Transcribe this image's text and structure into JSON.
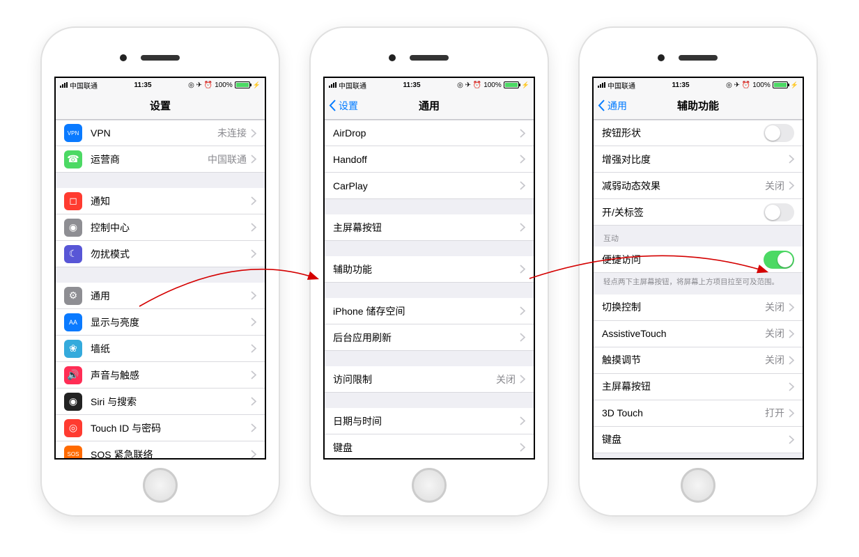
{
  "status": {
    "carrier": "中国联通",
    "time": "11:35",
    "battery": "100%"
  },
  "phone1": {
    "title": "设置",
    "rows": [
      {
        "label": "VPN",
        "value": "未连接",
        "iconBg": "#0a7aff",
        "iconText": "VPN",
        "iconTextSize": "8px"
      },
      {
        "label": "运营商",
        "value": "中国联通",
        "iconBg": "#4cd964",
        "iconText": "☎"
      }
    ],
    "group2": [
      {
        "label": "通知",
        "iconBg": "#ff3b30",
        "iconText": "◻"
      },
      {
        "label": "控制中心",
        "iconBg": "#8e8e93",
        "iconText": "◉"
      },
      {
        "label": "勿扰模式",
        "iconBg": "#5856d6",
        "iconText": "☾"
      }
    ],
    "group3": [
      {
        "label": "通用",
        "iconBg": "#8e8e93",
        "iconText": "⚙"
      },
      {
        "label": "显示与亮度",
        "iconBg": "#0a7aff",
        "iconText": "AA",
        "iconTextSize": "9px"
      },
      {
        "label": "墙纸",
        "iconBg": "#34aadc",
        "iconText": "❀"
      },
      {
        "label": "声音与触感",
        "iconBg": "#ff2d55",
        "iconText": "🔊"
      },
      {
        "label": "Siri 与搜索",
        "iconBg": "#222",
        "iconText": "◉"
      },
      {
        "label": "Touch ID 与密码",
        "iconBg": "#ff3b30",
        "iconText": "◎"
      },
      {
        "label": "SOS 紧急联络",
        "iconBg": "#ff6a00",
        "iconText": "SOS",
        "iconTextSize": "8px"
      }
    ]
  },
  "phone2": {
    "back": "设置",
    "title": "通用",
    "group1": [
      {
        "label": "AirDrop"
      },
      {
        "label": "Handoff"
      },
      {
        "label": "CarPlay"
      }
    ],
    "group2": [
      {
        "label": "主屏幕按钮"
      }
    ],
    "group3": [
      {
        "label": "辅助功能"
      }
    ],
    "group4": [
      {
        "label": "iPhone 储存空间"
      },
      {
        "label": "后台应用刷新"
      }
    ],
    "group5": [
      {
        "label": "访问限制",
        "value": "关闭"
      }
    ],
    "group6": [
      {
        "label": "日期与时间"
      },
      {
        "label": "键盘"
      }
    ]
  },
  "phone3": {
    "back": "通用",
    "title": "辅助功能",
    "group1": [
      {
        "label": "按钮形状",
        "toggle": "off"
      },
      {
        "label": "增强对比度",
        "chevron": true
      },
      {
        "label": "减弱动态效果",
        "value": "关闭",
        "chevron": true
      },
      {
        "label": "开/关标签",
        "toggle": "off"
      }
    ],
    "sectionHeader": "互动",
    "group2": [
      {
        "label": "便捷访问",
        "toggle": "on"
      }
    ],
    "footer": "轻点两下主屏幕按钮，将屏幕上方项目拉至可及范围。",
    "group3": [
      {
        "label": "切换控制",
        "value": "关闭",
        "chevron": true
      },
      {
        "label": "AssistiveTouch",
        "value": "关闭",
        "chevron": true
      },
      {
        "label": "触摸调节",
        "value": "关闭",
        "chevron": true
      },
      {
        "label": "主屏幕按钮",
        "chevron": true
      },
      {
        "label": "3D Touch",
        "value": "打开",
        "chevron": true
      },
      {
        "label": "键盘",
        "chevron": true
      }
    ]
  }
}
